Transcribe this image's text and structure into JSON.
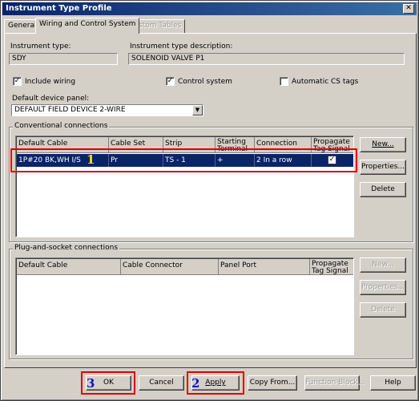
{
  "window": {
    "title": "Instrument Type Profile",
    "close_glyph": "✕"
  },
  "tabs": [
    {
      "label": "General",
      "state": "inactive"
    },
    {
      "label": "Wiring and Control System",
      "state": "active"
    },
    {
      "label": "Custom Tables",
      "state": "disabled"
    }
  ],
  "instrument_type": {
    "label": "Instrument type:",
    "value": "SDY"
  },
  "instrument_desc": {
    "label": "Instrument type description:",
    "value": "SOLENOID VALVE P1"
  },
  "checks": {
    "include_wiring": {
      "label": "Include wiring",
      "checked": true
    },
    "control_system": {
      "label": "Control system",
      "checked": true
    },
    "automatic_cs_tags": {
      "label": "Automatic CS tags",
      "checked": false
    }
  },
  "check_glyph": "✓",
  "device_panel": {
    "label": "Default device panel:",
    "value": "DEFAULT FIELD DEVICE 2-WIRE",
    "arrow_glyph": "▼"
  },
  "conventional": {
    "title": "Conventional connections",
    "columns": [
      "Default Cable",
      "Cable Set",
      "Strip",
      "Starting Terminal",
      "Connection Type",
      "Propagate Tag Signal"
    ],
    "rows": [
      {
        "default_cable": "1P#20 BK,WH I/S",
        "cable_set": "Pr",
        "strip": "TS - 1",
        "starting_terminal": "+",
        "connection_type": "2 In a row",
        "propagate": true
      }
    ],
    "buttons": {
      "new": "New...",
      "properties": "Properties...",
      "delete": "Delete"
    }
  },
  "plug_socket": {
    "title": "Plug-and-socket connections",
    "columns": [
      "Default Cable",
      "Cable Connector",
      "Panel Port",
      "Propagate Tag Signal"
    ],
    "buttons": {
      "new": "New...",
      "properties": "Properties...",
      "delete": "Delete"
    }
  },
  "footer": {
    "ok": "OK",
    "cancel": "Cancel",
    "apply": "Apply",
    "copy_from": "Copy From...",
    "function_block": "Function Block...",
    "help": "Help"
  },
  "annotations": {
    "marker_1": "1",
    "marker_2": "2",
    "marker_3": "3",
    "marker_color": "#e8e800",
    "marker_color_alt": "#1010c0",
    "highlight_color": "#e00000"
  }
}
